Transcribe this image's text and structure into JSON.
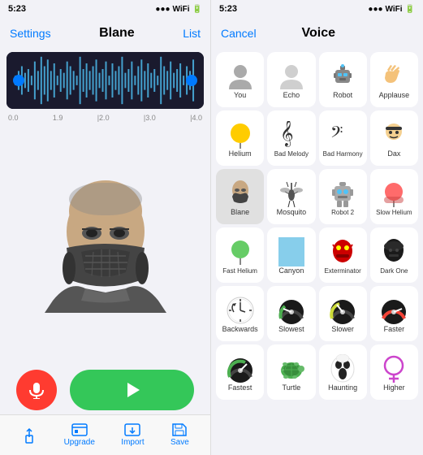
{
  "left": {
    "status_time": "5:23",
    "nav_left": "Settings",
    "nav_title": "Blane",
    "nav_right": "List",
    "waveform_labels": [
      "0.0",
      "1.9",
      "2.0",
      "3.0",
      "4.0"
    ],
    "toolbar_items": [
      {
        "icon": "⬆",
        "label": ""
      },
      {
        "icon": "",
        "label": "Upgrade"
      },
      {
        "icon": "",
        "label": "Import"
      },
      {
        "icon": "",
        "label": "Save"
      }
    ]
  },
  "right": {
    "status_time": "5:23",
    "nav_cancel": "Cancel",
    "nav_title": "Voice",
    "voices": [
      [
        {
          "label": "You",
          "icon": "👤"
        },
        {
          "label": "Echo",
          "icon": "👤"
        },
        {
          "label": "Robot",
          "icon": "🤖"
        },
        {
          "label": "Applause",
          "icon": "👋"
        }
      ],
      [
        {
          "label": "Helium",
          "icon": "🎈"
        },
        {
          "label": "Bad Melody",
          "icon": "🎵"
        },
        {
          "label": "Bad Harmony",
          "icon": "🎼"
        },
        {
          "label": "Dax",
          "icon": "😎"
        }
      ],
      [
        {
          "label": "Blane",
          "icon": "🎭"
        },
        {
          "label": "Mosquito",
          "icon": "🦟"
        },
        {
          "label": "Robot 2",
          "icon": "🤖"
        },
        {
          "label": "Slow Helium",
          "icon": "🎈"
        }
      ],
      [
        {
          "label": "Fast Helium",
          "icon": "🎈"
        },
        {
          "label": "Canyon",
          "icon": "🏔"
        },
        {
          "label": "Exterminator",
          "icon": "👾"
        },
        {
          "label": "Dark One",
          "icon": "🌑"
        }
      ],
      [
        {
          "label": "Backwards",
          "icon": "⏰"
        },
        {
          "label": "Slowest",
          "icon": "🟢"
        },
        {
          "label": "Slower",
          "icon": "🟡"
        },
        {
          "label": "Faster",
          "icon": "🔴"
        }
      ],
      [
        {
          "label": "Fastest",
          "icon": "🟢"
        },
        {
          "label": "Turtle",
          "icon": "🐢"
        },
        {
          "label": "Haunting",
          "icon": "👻"
        },
        {
          "label": "Higher",
          "icon": "♀"
        }
      ]
    ]
  }
}
